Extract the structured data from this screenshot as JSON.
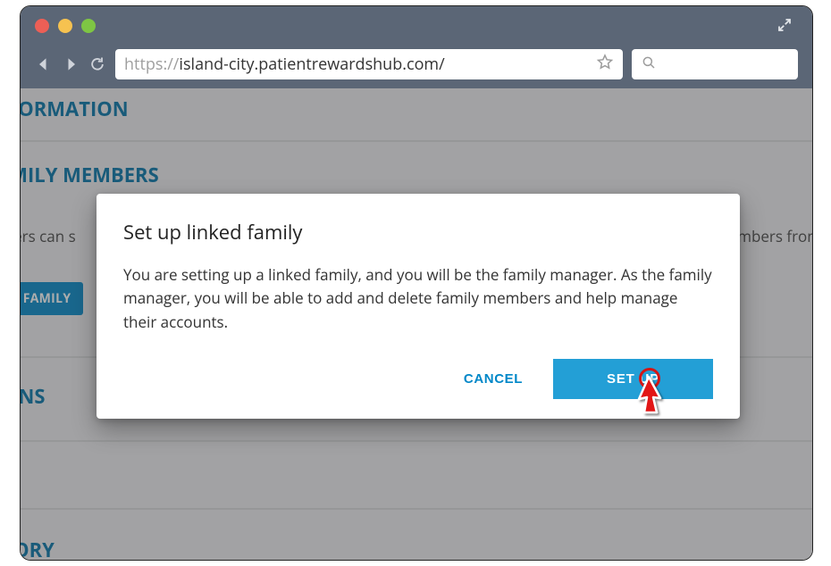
{
  "browser": {
    "url_gray_prefix": "https://",
    "url_black": "island-city.patientrewardshub.com/"
  },
  "background": {
    "heading_information": "INFORMATION",
    "heading_family": "FAMILY MEMBERS",
    "members_text_left": "mbers can s",
    "members_text_right": "embers from",
    "linked_family_button": "ED FAMILY",
    "heading_tions": "TIONS",
    "heading_istory": "ISTORY"
  },
  "dialog": {
    "title": "Set up linked family",
    "body": "You are setting up a linked family, and you will be the family manager. As the family manager, you will be able to add and delete family members and help manage their accounts.",
    "cancel_label": "CANCEL",
    "setup_label": "SET UP"
  }
}
